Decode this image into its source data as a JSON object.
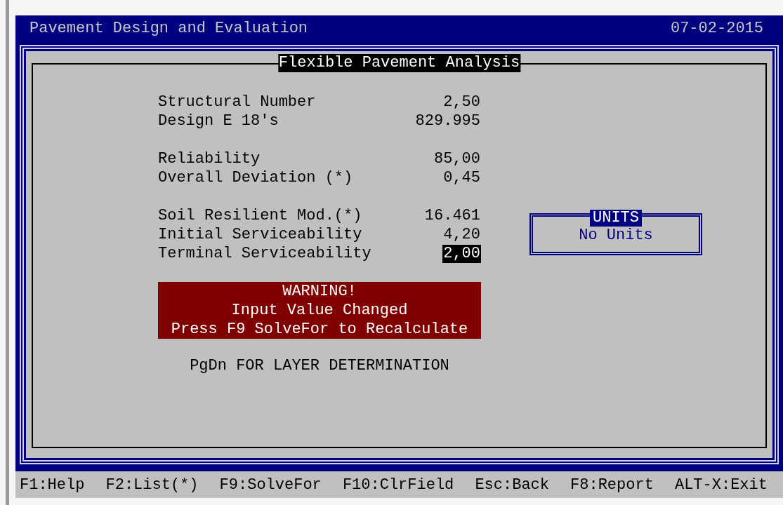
{
  "window": {
    "title": "Pavement Design and Evaluation",
    "date": "07-02-2015"
  },
  "panel": {
    "title": "Flexible Pavement Analysis"
  },
  "field_groups": [
    [
      {
        "label": "Structural Number",
        "value": "2,50",
        "selected": false
      },
      {
        "label": "Design E 18's",
        "value": "829.995",
        "selected": false
      }
    ],
    [
      {
        "label": "Reliability",
        "value": "85,00",
        "selected": false
      },
      {
        "label": "Overall Deviation (*)",
        "value": "0,45",
        "selected": false
      }
    ],
    [
      {
        "label": "Soil Resilient Mod.(*)",
        "value": "16.461",
        "selected": false
      },
      {
        "label": "Initial Serviceability",
        "value": "4,20",
        "selected": false
      },
      {
        "label": "Terminal Serviceability",
        "value": "2,00",
        "selected": true
      }
    ]
  ],
  "units": {
    "title": "UNITS",
    "value": "No Units"
  },
  "warning": {
    "lines": [
      "WARNING!",
      "Input Value Changed",
      "Press F9 SolveFor to Recalculate"
    ]
  },
  "hint": "PgDn FOR LAYER DETERMINATION",
  "function_keys": [
    "F1:Help",
    "F2:List(*)",
    "F9:SolveFor",
    "F10:ClrField",
    "Esc:Back",
    "F8:Report",
    "ALT-X:Exit"
  ]
}
